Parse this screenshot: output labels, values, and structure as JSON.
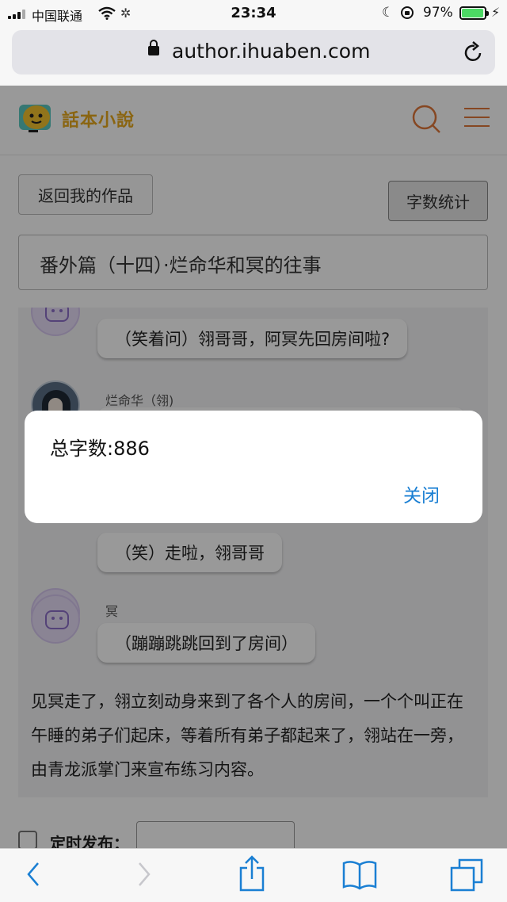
{
  "status_bar": {
    "carrier": "中国联通",
    "time": "23:34",
    "battery_percent": "97%",
    "battery_level": 0.97
  },
  "browser": {
    "url": "author.ihuaben.com"
  },
  "site": {
    "logo_text": "話本小說"
  },
  "editor": {
    "back_button": "返回我的作品",
    "word_count_button": "字数统计",
    "chapter_title": "番外篇（十四）·烂命华和冥的往事"
  },
  "chat": {
    "messages": [
      {
        "text": "（笑着问）翎哥哥，阿冥先回房间啦?"
      },
      {
        "speaker": "烂命华（翎)"
      },
      {
        "text": "（笑）走啦，翎哥哥"
      },
      {
        "speaker": "冥",
        "text": "（蹦蹦跳跳回到了房间）"
      }
    ],
    "narration": "见冥走了，翎立刻动身来到了各个人的房间，一个个叫正在午睡的弟子们起床，等着所有弟子都起来了，翎站在一旁，由青龙派掌门来宣布练习内容。"
  },
  "schedule": {
    "label": "定时发布："
  },
  "alert": {
    "message": "总字数:886",
    "close_label": "关闭"
  },
  "colors": {
    "accent": "#e0773a",
    "logo": "#e6a81d",
    "link": "#1a7fd3",
    "battery": "#4cd964"
  }
}
